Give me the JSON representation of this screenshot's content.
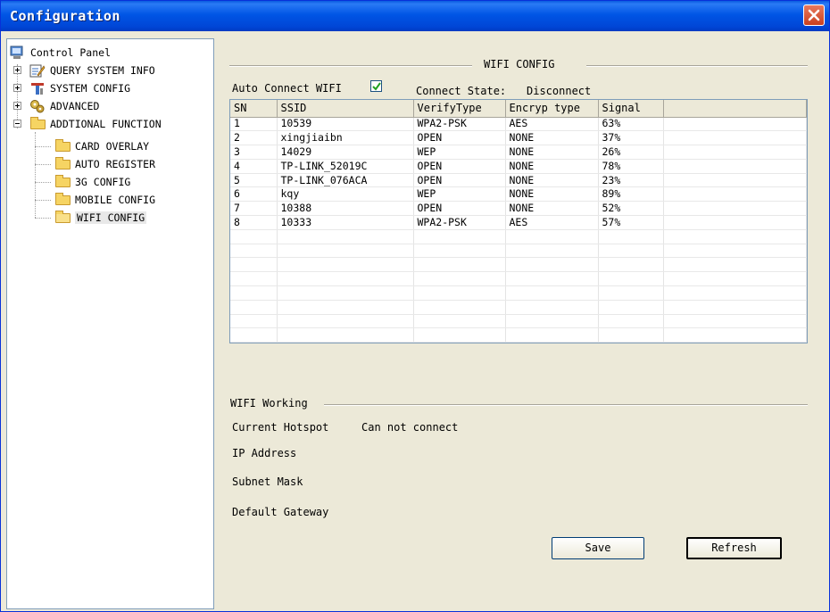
{
  "window": {
    "title": "Configuration"
  },
  "tree": {
    "root": "Control Panel",
    "items": [
      {
        "label": "QUERY SYSTEM INFO",
        "icon": "edit-document-icon"
      },
      {
        "label": "SYSTEM CONFIG",
        "icon": "tools-icon"
      },
      {
        "label": "ADVANCED",
        "icon": "gears-icon"
      },
      {
        "label": "ADDTIONAL FUNCTION",
        "icon": "folder-icon"
      }
    ],
    "children": [
      {
        "label": "CARD OVERLAY"
      },
      {
        "label": "AUTO REGISTER"
      },
      {
        "label": "3G CONFIG"
      },
      {
        "label": "MOBILE CONFIG"
      },
      {
        "label": "WIFI CONFIG"
      }
    ]
  },
  "wifi": {
    "group_title": "WIFI CONFIG",
    "auto_connect_label": "Auto Connect WIFI",
    "auto_connect_checked": true,
    "connect_state_label": "Connect State:",
    "connect_state_value": "Disconnect",
    "columns": [
      "SN",
      "SSID",
      "VerifyType",
      "Encryp type",
      "Signal"
    ],
    "rows": [
      [
        "1",
        "10539",
        "WPA2-PSK",
        "AES",
        "63%"
      ],
      [
        "2",
        "xingjiaibn",
        "OPEN",
        "NONE",
        "37%"
      ],
      [
        "3",
        "14029",
        "WEP",
        "NONE",
        "26%"
      ],
      [
        "4",
        "TP-LINK_52019C",
        "OPEN",
        "NONE",
        "78%"
      ],
      [
        "5",
        "TP-LINK_076ACA",
        "OPEN",
        "NONE",
        "23%"
      ],
      [
        "6",
        "kqy",
        "WEP",
        "NONE",
        "89%"
      ],
      [
        "7",
        "10388",
        "OPEN",
        "NONE",
        "52%"
      ],
      [
        "8",
        "10333",
        "WPA2-PSK",
        "AES",
        "57%"
      ]
    ]
  },
  "working": {
    "group_title": "WIFI Working",
    "current_hotspot_label": "Current Hotspot",
    "current_hotspot_value": "Can not connect",
    "ip_label": "IP Address",
    "subnet_label": "Subnet Mask",
    "gateway_label": "Default Gateway"
  },
  "buttons": {
    "save": "Save",
    "refresh": "Refresh"
  }
}
